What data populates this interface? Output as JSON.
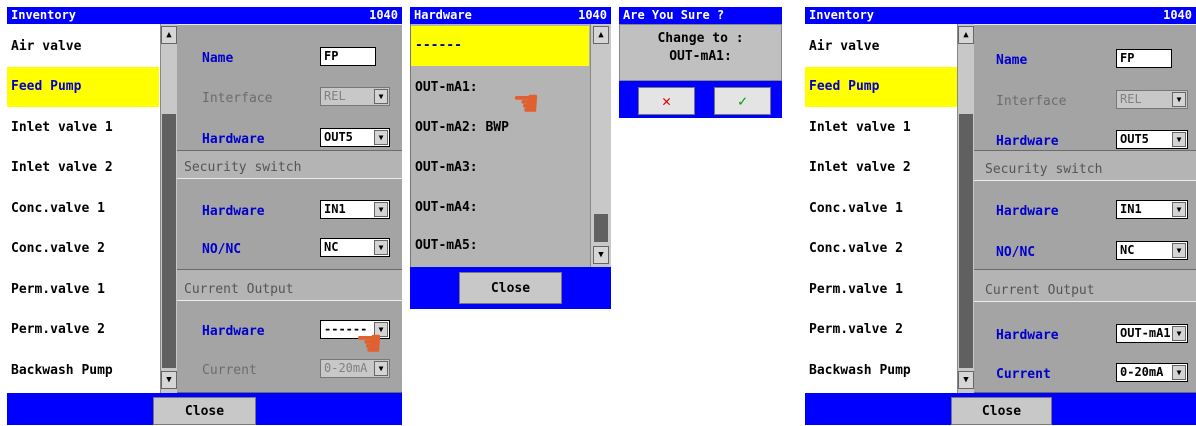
{
  "panel1": {
    "title": "Inventory",
    "id": "1040",
    "items": [
      "Air valve",
      "Feed Pump",
      "Inlet valve 1",
      "Inlet valve 2",
      "Conc.valve 1",
      "Conc.valve 2",
      "Perm.valve 1",
      "Perm.valve 2",
      "Backwash Pump"
    ],
    "selected_index": 1,
    "name_label": "Name",
    "name_value": "FP",
    "interface_label": "Interface",
    "interface_value": "REL",
    "hardware_label": "Hardware",
    "hardware_value": "OUT5",
    "security_header": "Security switch",
    "sec_hardware_label": "Hardware",
    "sec_hardware_value": "IN1",
    "nonc_label": "NO/NC",
    "nonc_value": "NC",
    "current_output_header": "Current Output",
    "co_hardware_label": "Hardware",
    "co_hardware_value": "------",
    "current_label": "Current",
    "current_value": "0-20mA",
    "close_label": "Close"
  },
  "panel2": {
    "title": "Hardware",
    "id": "1040",
    "items": [
      "------",
      "OUT-mA1:",
      "OUT-mA2: BWP",
      "OUT-mA3:",
      "OUT-mA4:",
      "OUT-mA5:"
    ],
    "selected_index": 0,
    "close_label": "Close"
  },
  "dialog": {
    "title": "Are You Sure ?",
    "line1": "Change to :",
    "line2": "OUT-mA1:",
    "no_label": "✕",
    "yes_label": "✓",
    "colors": {
      "no": "#e00000",
      "yes": "#00a000"
    }
  },
  "panel3": {
    "title": "Inventory",
    "id": "1040",
    "items": [
      "Air valve",
      "Feed Pump",
      "Inlet valve 1",
      "Inlet valve 2",
      "Conc.valve 1",
      "Conc.valve 2",
      "Perm.valve 1",
      "Perm.valve 2",
      "Backwash Pump"
    ],
    "selected_index": 1,
    "name_label": "Name",
    "name_value": "FP",
    "interface_label": "Interface",
    "interface_value": "REL",
    "hardware_label": "Hardware",
    "hardware_value": "OUT5",
    "security_header": "Security switch",
    "sec_hardware_label": "Hardware",
    "sec_hardware_value": "IN1",
    "nonc_label": "NO/NC",
    "nonc_value": "NC",
    "current_output_header": "Current Output",
    "co_hardware_label": "Hardware",
    "co_hardware_value": "OUT-mA1",
    "current_label": "Current",
    "current_value": "0-20mA",
    "close_label": "Close"
  },
  "icons": {
    "pointer": "pointing-hand-icon",
    "dropdown": "chevron-down-icon",
    "scroll_up": "scroll-up-icon",
    "scroll_down": "scroll-down-icon"
  },
  "colors": {
    "titlebar": "#0000ff",
    "selected": "#ffff00",
    "label": "#0000cc",
    "form_bg": "#b4b4b4"
  }
}
